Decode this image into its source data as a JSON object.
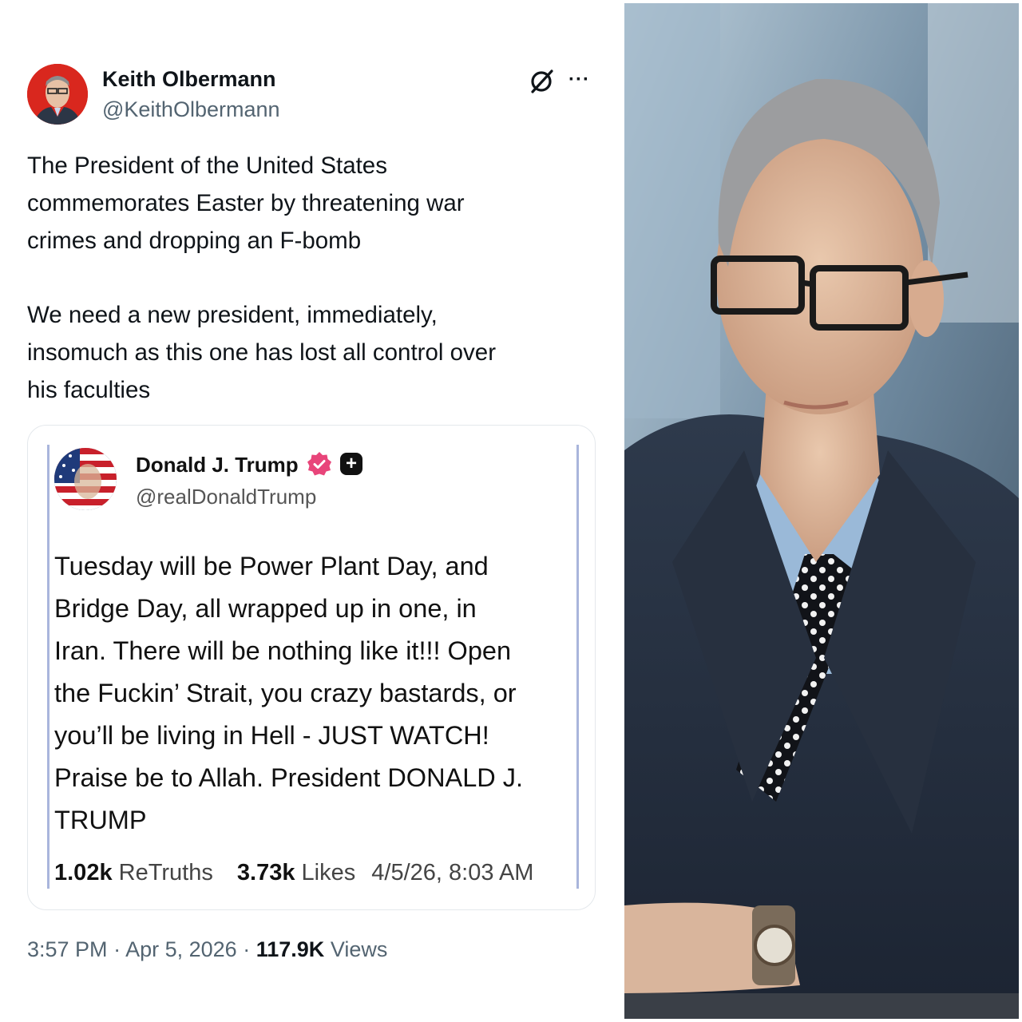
{
  "tweet": {
    "author_name": "Keith Olbermann",
    "author_handle": "@KeithOlbermann",
    "grok_icon": "grok-slash-icon",
    "more_icon": "more-horizontal-icon",
    "more_label": "···",
    "paragraph1": [
      "The President of the United States",
      "commemorates Easter by threatening war",
      "crimes and dropping an F-bomb"
    ],
    "paragraph2": [
      "We need a new president, immediately,",
      "insomuch as this one has lost all control over",
      "his faculties"
    ],
    "time": "3:57 PM",
    "date": "Apr 5, 2026",
    "separator": "·",
    "views_count": "117.9K",
    "views_label": "Views"
  },
  "quoted": {
    "name": "Donald J. Trump",
    "handle": "@realDonaldTrump",
    "verified_icon": "verified-badge-icon",
    "plus_icon": "plus-badge-icon",
    "plus_label": "+",
    "text": [
      "Tuesday will be Power Plant Day, and",
      "Bridge Day, all wrapped up in one, in",
      "Iran. There will be nothing like it!!! Open",
      "the Fuckin’ Strait, you crazy bastards, or",
      "you’ll be living in Hell - JUST WATCH!",
      "Praise be to Allah. President DONALD J.",
      "TRUMP"
    ],
    "retruths_count": "1.02k",
    "retruths_label": "ReTruths",
    "likes_count": "3.73k",
    "likes_label": "Likes",
    "timestamp": "4/5/26, 8:03 AM"
  },
  "colors": {
    "text_primary": "#0f1419",
    "text_secondary": "#536471",
    "verified_pink": "#e8457a",
    "quote_rule": "#a9b5dc"
  }
}
